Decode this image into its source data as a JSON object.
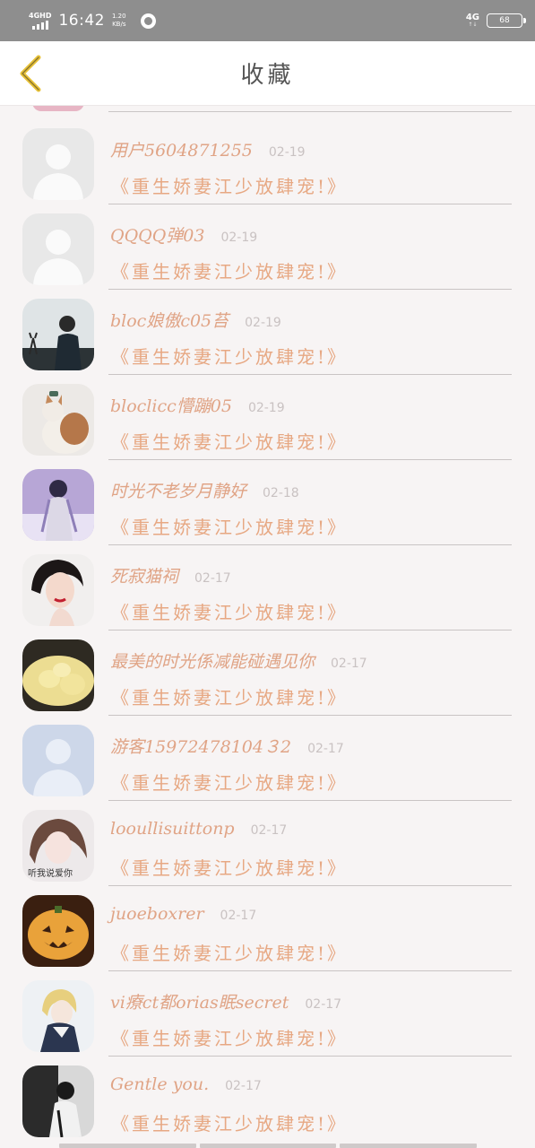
{
  "status_bar": {
    "network_left": "4GHD",
    "time": "16:42",
    "speed_value": "1.20",
    "speed_unit": "KB/s",
    "network_right": "4G",
    "battery": "68"
  },
  "header": {
    "title": "收藏",
    "back_icon": "chevron-left-icon"
  },
  "items": [
    {
      "username": "用户5604871255",
      "date": "02-19",
      "book": "《重生娇妻江少放肆宠!》",
      "avatar": "default-person"
    },
    {
      "username": "QQQQ弹03",
      "date": "02-19",
      "book": "《重生娇妻江少放肆宠!》",
      "avatar": "default-person"
    },
    {
      "username": "bloc娘傲c05苔",
      "date": "02-19",
      "book": "《重生娇妻江少放肆宠!》",
      "avatar": "photo-silhouette"
    },
    {
      "username": "bloclicc懵蹦05",
      "date": "02-19",
      "book": "《重生娇妻江少放肆宠!》",
      "avatar": "photo-cat"
    },
    {
      "username": "时光不老岁月静好",
      "date": "02-18",
      "book": "《重生娇妻江少放肆宠!》",
      "avatar": "photo-anime-purple"
    },
    {
      "username": "死寂猫祠",
      "date": "02-17",
      "book": "《重生娇妻江少放肆宠!》",
      "avatar": "photo-woman"
    },
    {
      "username": "最美的时光係减能碰遇见你",
      "date": "02-17",
      "book": "《重生娇妻江少放肆宠!》",
      "avatar": "photo-food"
    },
    {
      "username": "游客15972478104３2",
      "date": "02-17",
      "book": "《重生娇妻江少放肆宠!》",
      "avatar": "default-person-blue"
    },
    {
      "username": "looullisuittonp",
      "date": "02-17",
      "book": "《重生娇妻江少放肆宠!》",
      "avatar": "photo-girl-caption",
      "avatar_caption": "听我说爱你"
    },
    {
      "username": "juoeboxrer",
      "date": "02-17",
      "book": "《重生娇妻江少放肆宠!》",
      "avatar": "photo-pumpkin"
    },
    {
      "username": "vi療ct都orias眠secret",
      "date": "02-17",
      "book": "《重生娇妻江少放肆宠!》",
      "avatar": "photo-anime-blond"
    },
    {
      "username": "Gentle you.",
      "date": "02-17",
      "book": "《重生娇妻江少放肆宠!》",
      "avatar": "photo-dark-bw"
    }
  ],
  "colors": {
    "username": "#e0a486",
    "book": "#e7a883",
    "date": "#c9c2c2",
    "back_arrow": "#e8c33a",
    "status_bar": "#8e8e8e"
  }
}
